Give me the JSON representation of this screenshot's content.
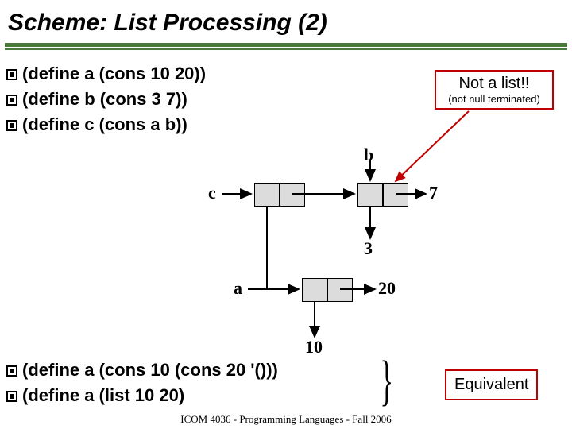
{
  "title": "Scheme: List Processing (2)",
  "topCode": {
    "line1": "(define a (cons 10 20))",
    "line2": "(define b (cons 3 7))",
    "line3": "(define c (cons a b))"
  },
  "callout1": {
    "main": "Not a list!!",
    "sub": "(not null terminated)"
  },
  "diagramLabels": {
    "a": "a",
    "b": "b",
    "c": "c",
    "v3": "3",
    "v7": "7",
    "v10": "10",
    "v20": "20"
  },
  "bottomCode": {
    "line1": "(define a (cons 10 (cons 20 '()))",
    "line2": "(define a (list 10 20)"
  },
  "callout2": {
    "text": "Equivalent"
  },
  "footer": "ICOM 4036 - Programming Languages - Fall 2006"
}
